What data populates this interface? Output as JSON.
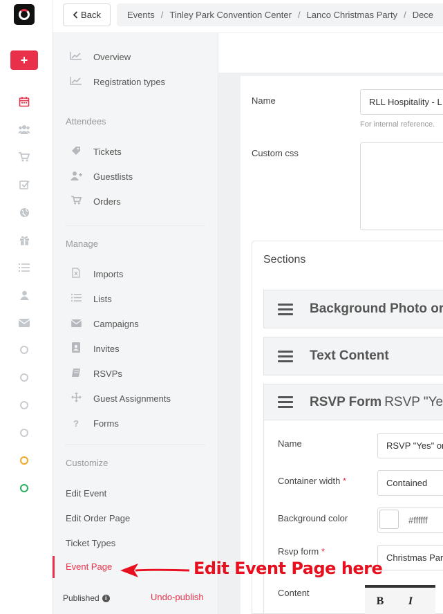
{
  "topbar": {
    "back_label": "Back",
    "breadcrumbs": [
      "Events",
      "Tinley Park Convention Center",
      "Lanco Christmas Party",
      "Dece"
    ]
  },
  "rail": {
    "icons": [
      "calendar-icon",
      "users-icon",
      "cart-icon",
      "checklist-icon",
      "globe-icon",
      "gift-icon",
      "list-icon",
      "user-icon",
      "envelope-icon"
    ],
    "circle_colors": [
      "#c9cdd1",
      "#c9cdd1",
      "#c9cdd1",
      "#c9cdd1",
      "#f5a623",
      "#27ae60"
    ]
  },
  "subnav": {
    "overview": "Overview",
    "registration_types": "Registration types",
    "attendees_heading": "Attendees",
    "tickets": "Tickets",
    "guestlists": "Guestlists",
    "orders": "Orders",
    "manage_heading": "Manage",
    "imports": "Imports",
    "lists": "Lists",
    "campaigns": "Campaigns",
    "invites": "Invites",
    "rsvps": "RSVPs",
    "guest_assignments": "Guest Assignments",
    "forms": "Forms",
    "customize_heading": "Customize",
    "edit_event": "Edit Event",
    "edit_order_page": "Edit Order Page",
    "ticket_types": "Ticket Types",
    "event_page": "Event Page",
    "published": "Published",
    "undo_publish": "Undo-publish"
  },
  "form": {
    "name_label": "Name",
    "name_value": "RLL Hospitality - L",
    "name_help": "For internal reference.",
    "css_label": "Custom css",
    "sections_title": "Sections",
    "section1": "Background Photo or",
    "section2": "Text Content",
    "section3_name": "RSVP Form",
    "section3_sub": "RSVP \"Ye",
    "inner": {
      "name_label": "Name",
      "name_value": "RSVP \"Yes\" or",
      "width_label": "Container width",
      "width_value": "Contained",
      "bg_label": "Background color",
      "bg_value": "#ffffff",
      "rsvp_label": "Rsvp form",
      "rsvp_value": "Christmas Par",
      "content_label": "Content",
      "bold": "B",
      "italic": "I"
    }
  },
  "annotation": "Edit Event Page here",
  "colors": {
    "accent": "#e8304a",
    "annotation": "#e8101f"
  }
}
